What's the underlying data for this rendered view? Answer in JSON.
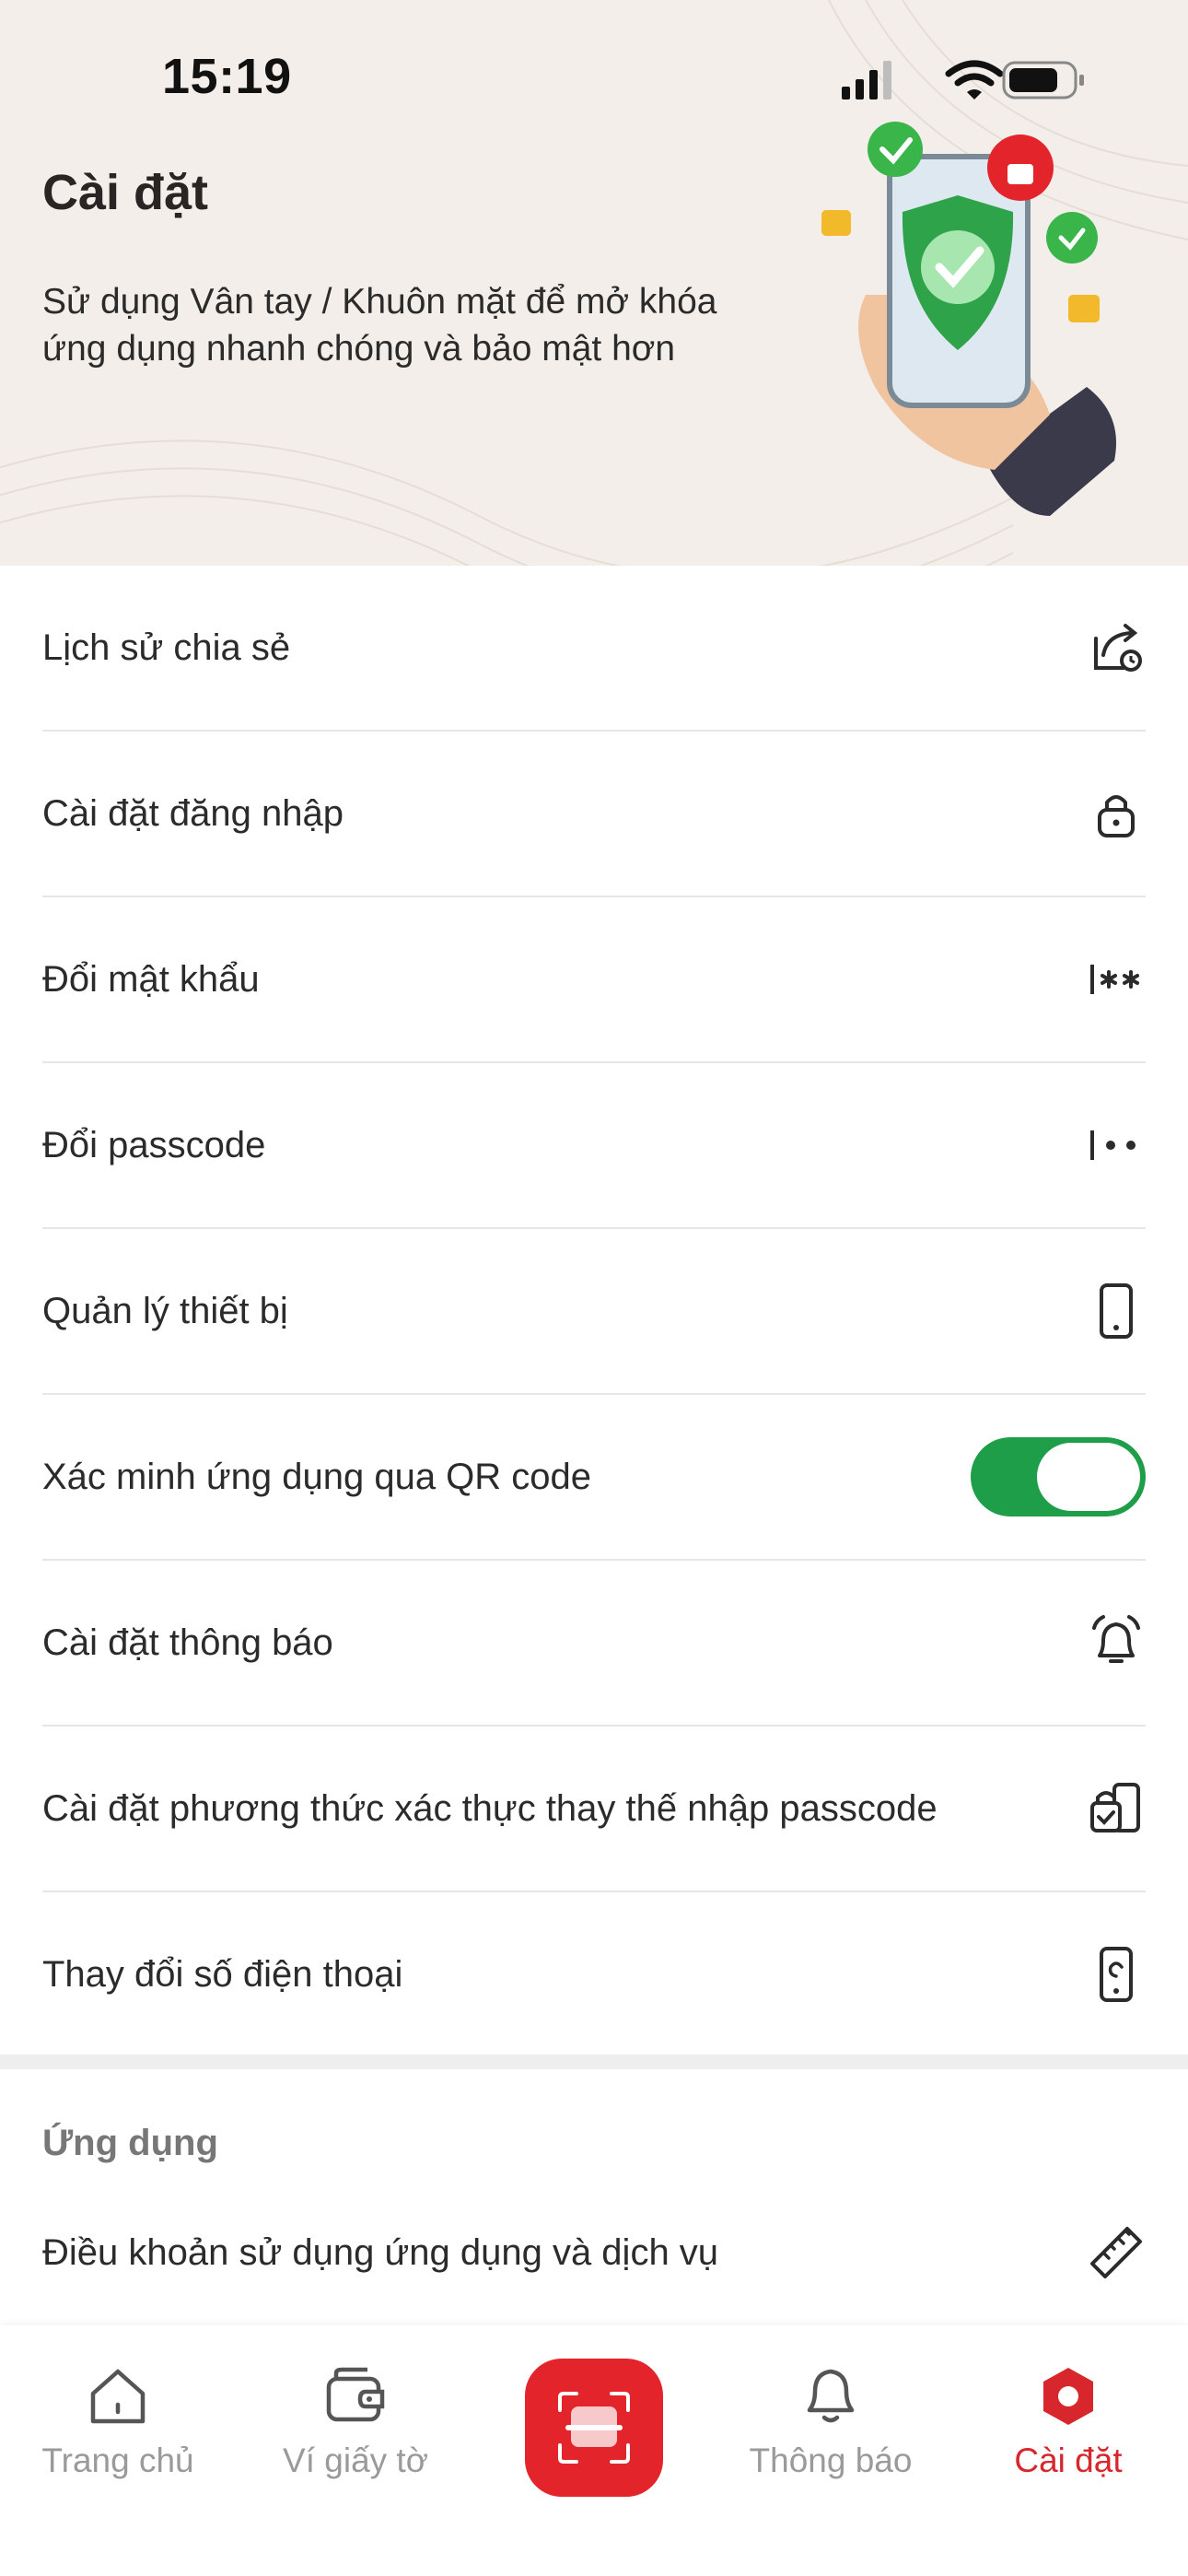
{
  "status_bar": {
    "time": "15:19"
  },
  "header": {
    "title": "Cài đặt",
    "description": "Sử dụng Vân tay / Khuôn mặt để mở khóa ứng dụng nhanh chóng và bảo mật hơn"
  },
  "settings": [
    {
      "label": "Lịch sử chia sẻ",
      "icon": "share-history-icon"
    },
    {
      "label": "Cài đặt đăng nhập",
      "icon": "lock-icon"
    },
    {
      "label": "Đổi mật khẩu",
      "icon": "password-icon"
    },
    {
      "label": "Đổi passcode",
      "icon": "passcode-icon"
    },
    {
      "label": "Quản lý thiết bị",
      "icon": "device-icon"
    },
    {
      "label": "Xác minh ứng dụng qua QR code",
      "toggle": true,
      "toggle_on": true
    },
    {
      "label": "Cài đặt thông báo",
      "icon": "bell-icon"
    },
    {
      "label": "Cài đặt phương thức xác thực thay thế nhập passcode",
      "icon": "auth-method-icon"
    },
    {
      "label": "Thay đổi số điện thoại",
      "icon": "phone-change-icon"
    }
  ],
  "app_section": {
    "title": "Ứng dụng",
    "items": [
      {
        "label": "Điều khoản sử dụng ứng dụng và dịch vụ",
        "icon": "ruler-icon"
      }
    ]
  },
  "bottom_nav": {
    "items": [
      {
        "label": "Trang chủ",
        "icon": "home-icon",
        "active": false
      },
      {
        "label": "Ví giấy tờ",
        "icon": "wallet-icon",
        "active": false
      },
      {
        "label": "",
        "icon": "scan-icon",
        "active": false
      },
      {
        "label": "Thông báo",
        "icon": "bell-icon",
        "active": false
      },
      {
        "label": "Cài đặt",
        "icon": "settings-icon",
        "active": true
      }
    ]
  },
  "colors": {
    "accent_red": "#e4242b",
    "toggle_green": "#1e9e49",
    "header_bg": "#f3eeea",
    "active_nav": "#d7262c"
  }
}
